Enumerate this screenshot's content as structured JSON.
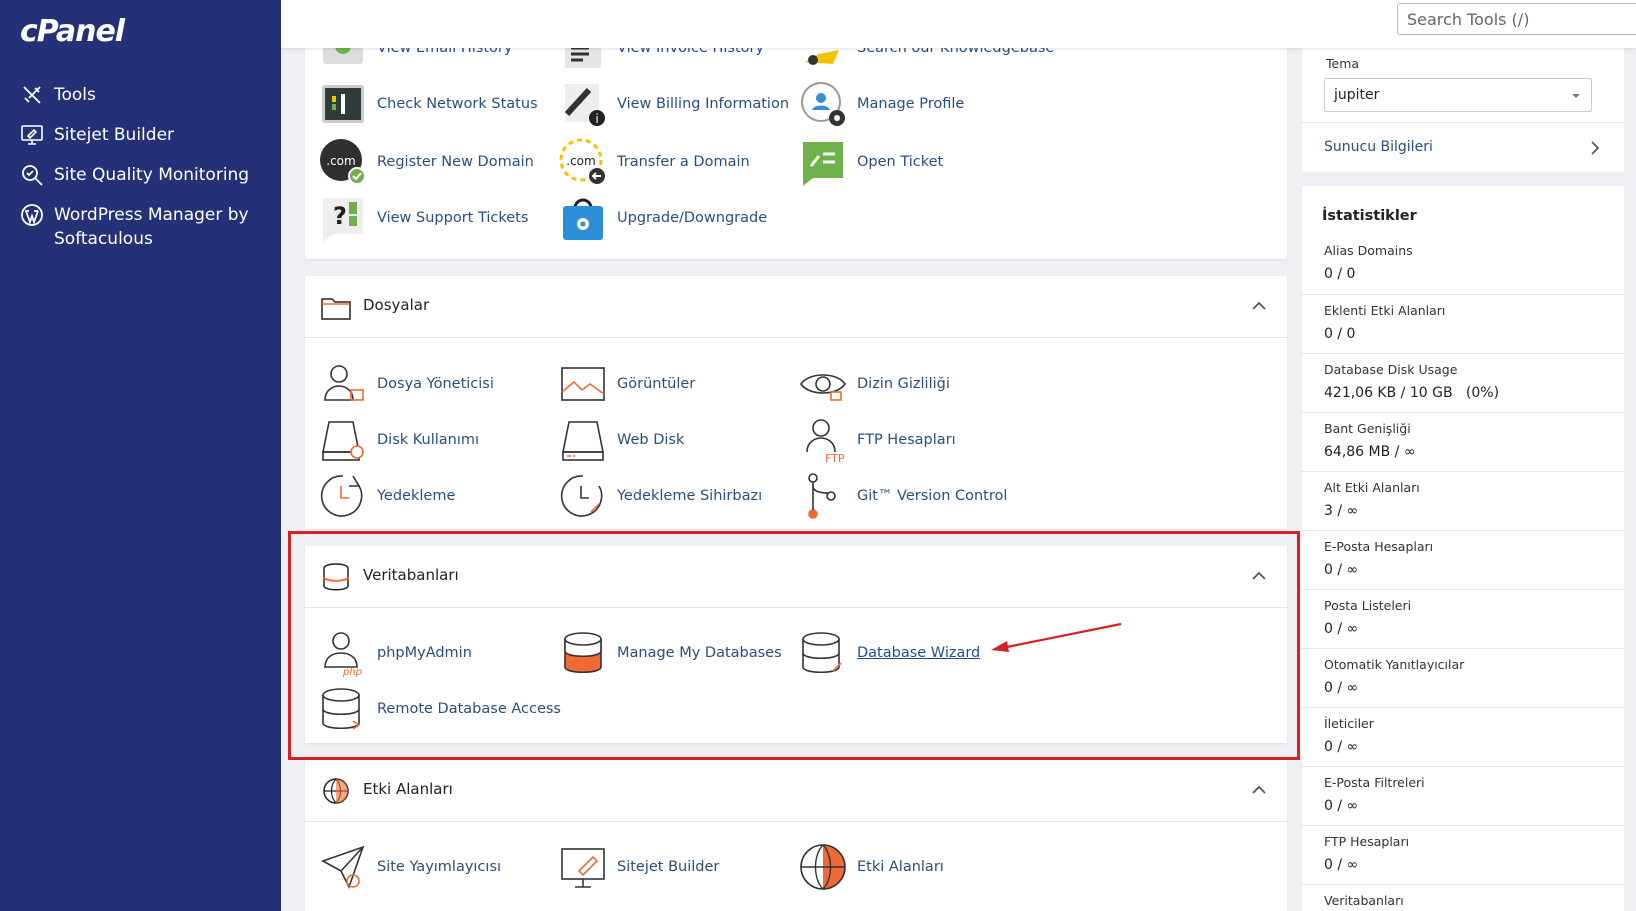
{
  "app": {
    "logo": "cPanel"
  },
  "sidebar": {
    "items": [
      {
        "label": "Tools",
        "icon": "tools-icon"
      },
      {
        "label": "Sitejet Builder",
        "icon": "sitejet-icon"
      },
      {
        "label": "Site Quality Monitoring",
        "icon": "magnifier-icon"
      },
      {
        "label": "WordPress Manager by Softaculous",
        "icon": "wordpress-icon"
      }
    ]
  },
  "search": {
    "placeholder": "Search Tools (/)"
  },
  "general": {
    "items": [
      {
        "label": "View Email History"
      },
      {
        "label": "View Invoice History"
      },
      {
        "label": "Search our Knowledgebase"
      },
      {
        "label": "Check Network Status"
      },
      {
        "label": "View Billing Information"
      },
      {
        "label": "Manage Profile"
      },
      {
        "label": "Register New Domain"
      },
      {
        "label": "Transfer a Domain"
      },
      {
        "label": "Open Ticket"
      },
      {
        "label": "View Support Tickets"
      },
      {
        "label": "Upgrade/Downgrade"
      }
    ]
  },
  "files": {
    "title": "Dosyalar",
    "items": [
      {
        "label": "Dosya Yöneticisi"
      },
      {
        "label": "Görüntüler"
      },
      {
        "label": "Dizin Gizliliği"
      },
      {
        "label": "Disk Kullanımı"
      },
      {
        "label": "Web Disk"
      },
      {
        "label": "FTP Hesapları"
      },
      {
        "label": "Yedekleme"
      },
      {
        "label": "Yedekleme Sihirbazı"
      },
      {
        "label": "Git™ Version Control"
      }
    ]
  },
  "databases": {
    "title": "Veritabanları",
    "items": [
      {
        "label": "phpMyAdmin"
      },
      {
        "label": "Manage My Databases"
      },
      {
        "label": "Database Wizard"
      },
      {
        "label": "Remote Database Access"
      }
    ]
  },
  "domains": {
    "title": "Etki Alanları",
    "items": [
      {
        "label": "Site Yayımlayıcısı"
      },
      {
        "label": "Sitejet Builder"
      },
      {
        "label": "Etki Alanları"
      }
    ]
  },
  "right": {
    "theme_label": "Tema",
    "theme_value": "jupiter",
    "server_info": "Sunucu Bilgileri",
    "stats_title": "İstatistikler",
    "stats": [
      {
        "label": "Alias Domains",
        "value": "0 / 0"
      },
      {
        "label": "Eklenti Etki Alanları",
        "value": "0 / 0"
      },
      {
        "label": "Database Disk Usage",
        "value": "421,06 KB / 10 GB   (0%)"
      },
      {
        "label": "Bant Genişliği",
        "value": "64,86 MB / ∞"
      },
      {
        "label": "Alt Etki Alanları",
        "value": "3 / ∞"
      },
      {
        "label": "E-Posta Hesapları",
        "value": "0 / ∞"
      },
      {
        "label": "Posta Listeleri",
        "value": "0 / ∞"
      },
      {
        "label": "Otomatik Yanıtlayıcılar",
        "value": "0 / ∞"
      },
      {
        "label": "İleticiler",
        "value": "0 / ∞"
      },
      {
        "label": "E-Posta Filtreleri",
        "value": "0 / ∞"
      },
      {
        "label": "FTP Hesapları",
        "value": "0 / ∞"
      },
      {
        "label": "Veritabanları",
        "value": ""
      }
    ]
  },
  "colors": {
    "sidebar": "#253177",
    "accent_orange": "#f06a35",
    "link": "#294f7e",
    "highlight": "#d42027"
  }
}
